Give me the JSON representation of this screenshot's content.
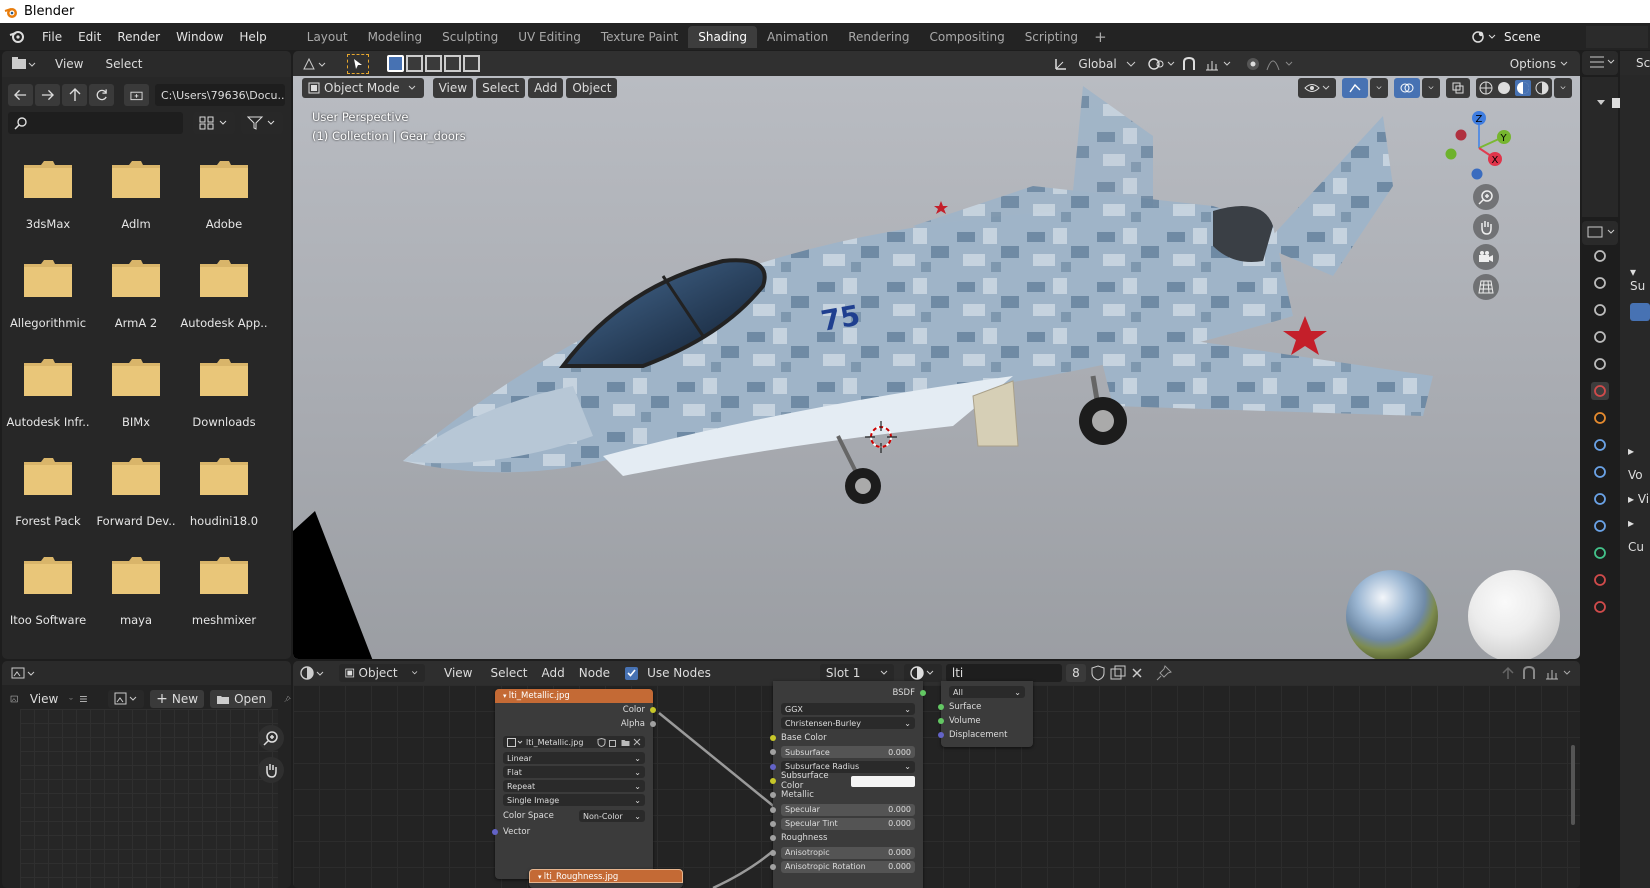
{
  "window": {
    "title": "Blender"
  },
  "menu": [
    "File",
    "Edit",
    "Render",
    "Window",
    "Help"
  ],
  "workspaces": [
    "Layout",
    "Modeling",
    "Sculpting",
    "UV Editing",
    "Texture Paint",
    "Shading",
    "Animation",
    "Rendering",
    "Compositing",
    "Scripting"
  ],
  "active_workspace": "Shading",
  "scene": {
    "name": "Scene",
    "sidebar_trunc": "Sce",
    "sidebar_trunc2": "Su"
  },
  "file_browser": {
    "view": "View",
    "select": "Select",
    "path": "C:\\Users\\79636\\Docu..",
    "search_placeholder": "",
    "folders": [
      "3dsMax",
      "Adlm",
      "Adobe",
      "Allegorithmic",
      "ArmA 2",
      "Autodesk App..",
      "Autodesk Infr..",
      "BIMx",
      "Downloads",
      "Forest Pack",
      "Forward Dev..",
      "houdini18.0",
      "Itoo Software",
      "maya",
      "meshmixer"
    ]
  },
  "viewport": {
    "header": {
      "mode": "Object Mode",
      "view": "View",
      "select": "Select",
      "add": "Add",
      "object": "Object"
    },
    "tool_header": {
      "orientation": "Global",
      "options": "Options"
    },
    "overlay_text": {
      "perspective": "User Perspective",
      "collection": "(1) Collection | Gear_doors"
    },
    "gizmo": {
      "z": "Z",
      "y": "Y",
      "x": "X"
    },
    "aircraft_number": "75"
  },
  "image_editor": {
    "view": "View",
    "new": "New",
    "open": "Open"
  },
  "node_editor": {
    "header": {
      "type": "Object",
      "view": "View",
      "select": "Select",
      "add": "Add",
      "node": "Node",
      "use_nodes": "Use Nodes",
      "slot": "Slot 1",
      "material": "lti",
      "users": "8"
    },
    "image_node": {
      "title": "lti_Metallic.jpg",
      "out_color": "Color",
      "out_alpha": "Alpha",
      "image_name": "lti_Metallic.jpg",
      "interpolation": "Linear",
      "projection": "Flat",
      "extension": "Repeat",
      "source": "Single Image",
      "color_space_label": "Color Space",
      "color_space": "Non-Color",
      "in_vector": "Vector"
    },
    "image_node2": {
      "title": "lti_Roughness.jpg"
    },
    "bsdf": {
      "out": "BSDF",
      "distribution": "GGX",
      "subsurface_method": "Christensen-Burley",
      "rows": [
        {
          "label": "Base Color",
          "type": "socket"
        },
        {
          "label": "Subsurface",
          "type": "value",
          "value": "0.000"
        },
        {
          "label": "Subsurface Radius",
          "type": "dropdown"
        },
        {
          "label": "Subsurface Color",
          "type": "color"
        },
        {
          "label": "Metallic",
          "type": "socket"
        },
        {
          "label": "Specular",
          "type": "value",
          "value": "0.000"
        },
        {
          "label": "Specular Tint",
          "type": "value",
          "value": "0.000"
        },
        {
          "label": "Roughness",
          "type": "socket"
        },
        {
          "label": "Anisotropic",
          "type": "value",
          "value": "0.000"
        },
        {
          "label": "Anisotropic Rotation",
          "type": "value",
          "value": "0.000"
        }
      ]
    },
    "output": {
      "target": "All",
      "surface": "Surface",
      "volume": "Volume",
      "displacement": "Displacement"
    }
  },
  "right_panel": {
    "items": [
      "Vo",
      "Vi",
      "Cu"
    ]
  }
}
